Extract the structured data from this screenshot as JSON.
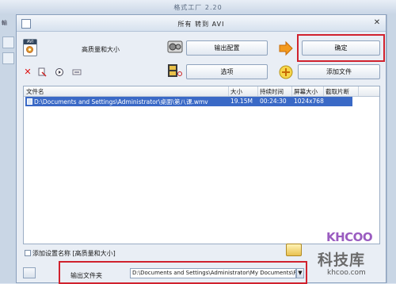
{
  "background_window": {
    "title": "格式工厂 2.20",
    "left_label": "輸"
  },
  "dialog": {
    "title": "所有 转到 AVI",
    "close": "✕"
  },
  "profile": {
    "label": "高质量和大小",
    "app_icon_tag": "AVI"
  },
  "buttons": {
    "output_config": "输出配置",
    "ok": "确定",
    "options": "选项",
    "add_file": "添加文件"
  },
  "toolbar_icons": [
    "delete-icon",
    "clear-icon",
    "play-icon",
    "info-icon"
  ],
  "table": {
    "headers": [
      "文件名",
      "大小",
      "持续时间",
      "屏幕大小",
      "截取片断"
    ],
    "rows": [
      {
        "filename": "D:\\Documents and Settings\\Administrator\\桌面\\第八课.wmv",
        "size": "19.15M",
        "duration": "00:24:30",
        "screen": "1024x768",
        "clip": ""
      }
    ]
  },
  "save_setting": {
    "label": "添加设置名称 [高质量和大小]"
  },
  "output": {
    "label": "输出文件夹",
    "path": "D:\\Documents and Settings\\Administrator\\My Documents\\FFO"
  },
  "watermark": {
    "brand": "KHCOO",
    "chinese": "科技库",
    "url": "khcoo.com"
  },
  "colors": {
    "highlight": "#d0222e",
    "selection": "#3a69c6"
  }
}
